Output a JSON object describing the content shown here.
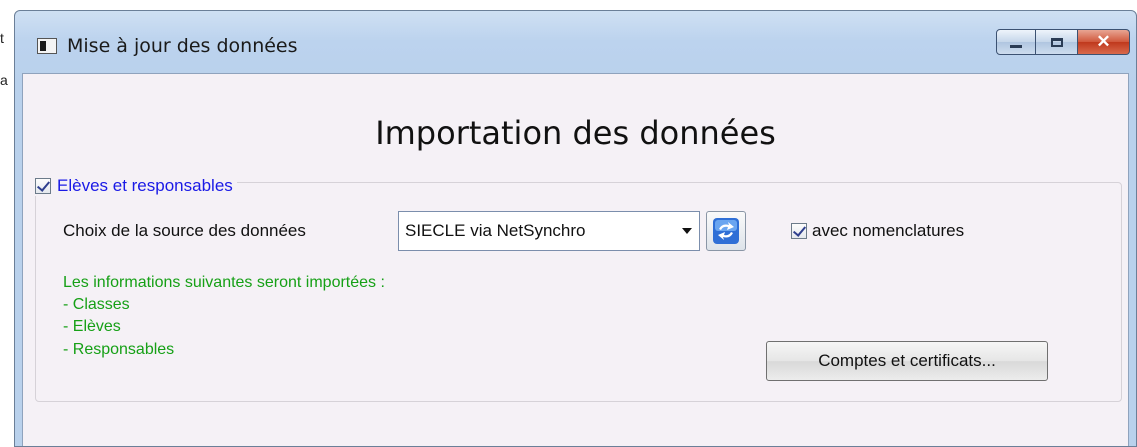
{
  "window": {
    "title": "Mise à jour des données",
    "close_glyph": "✕"
  },
  "main": {
    "heading": "Importation des données"
  },
  "group": {
    "checkbox_label": "Elèves et responsables",
    "checked": true,
    "source_label": "Choix de la source des données",
    "source_value": "SIECLE via NetSynchro",
    "nomenclature_label": "avec nomenclatures",
    "nomenclature_checked": true,
    "info_heading": "Les informations suivantes seront importées :",
    "info_items": [
      "- Classes",
      "- Elèves",
      "- Responsables"
    ],
    "accounts_button": "Comptes et certificats..."
  },
  "colors": {
    "legend_text": "#1a1ae6",
    "info_text": "#16a016",
    "client_bg": "#f5f1f6"
  },
  "icons": [
    "app-window-icon",
    "minimize-icon",
    "maximize-icon",
    "close-icon",
    "dropdown-arrow-icon",
    "sync-icon",
    "checkmark-icon"
  ]
}
